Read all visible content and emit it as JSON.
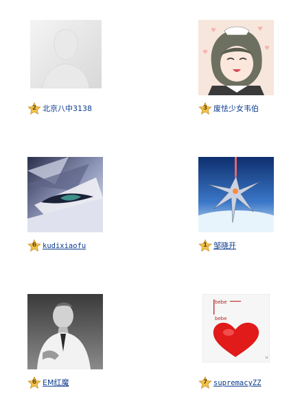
{
  "friends": [
    {
      "name": "北京八中3138",
      "level": "2"
    },
    {
      "name": "废怯少女韦伯",
      "level": "3"
    },
    {
      "name": "kudixiaofu",
      "level": "6"
    },
    {
      "name": "邹晓开",
      "level": "1"
    },
    {
      "name": "EM红魔",
      "level": "6"
    },
    {
      "name": "supremacyZZ",
      "level": "7"
    }
  ]
}
